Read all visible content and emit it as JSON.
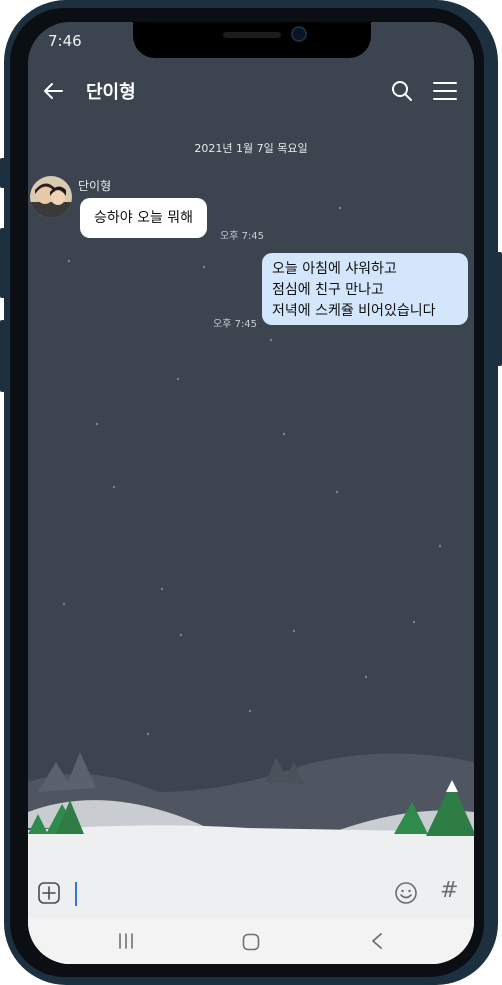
{
  "status_bar": {
    "time": "7:46"
  },
  "header": {
    "title": "단이형"
  },
  "chat": {
    "date_divider": "2021년 1월 7일 목요일",
    "incoming": {
      "sender": "단이형",
      "text": "승하야 오늘 뭐해",
      "time": "오후 7:45"
    },
    "outgoing": {
      "lines": [
        "오늘 아침에 샤워하고",
        "점심에 친구 만나고",
        "저녁에 스케쥴 비어있습니다"
      ],
      "time": "오후 7:45"
    }
  },
  "input_bar": {
    "icons": [
      "plus-icon",
      "emoji-icon",
      "hashtag-icon"
    ],
    "hash_symbol": "#"
  },
  "nav_bar": {
    "icons": [
      "recent-apps-icon",
      "home-icon",
      "back-icon"
    ]
  },
  "colors": {
    "chat_bg": "#3b4450",
    "outgoing_bubble": "#d3e6fb",
    "incoming_bubble": "#ffffff",
    "frame": "#1d3040"
  }
}
